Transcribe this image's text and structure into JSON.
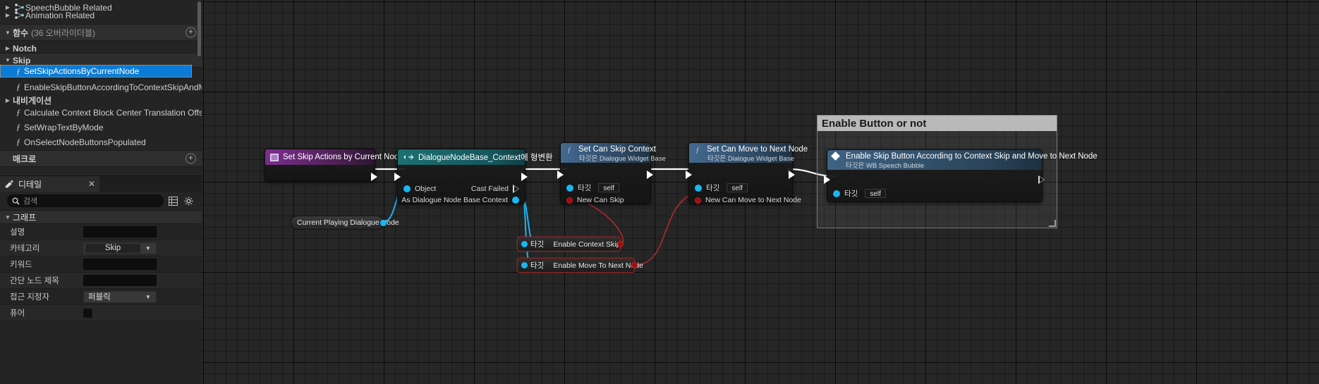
{
  "sidebar": {
    "tree_items": [
      {
        "label": "SpeechBubble Related",
        "type": "category-graph",
        "arrow": "collapsed",
        "indent": 1,
        "selected": false
      },
      {
        "label": "Animation Related",
        "type": "category-graph",
        "arrow": "collapsed",
        "indent": 1,
        "selected": false
      }
    ],
    "functions_header": {
      "label": "함수",
      "count": "(36 오버라이더블)",
      "arrow": "expanded"
    },
    "groups": [
      {
        "label": "Notch",
        "arrow": "collapsed"
      },
      {
        "label": "Skip",
        "arrow": "expanded"
      }
    ],
    "skip_functions": [
      {
        "label": "SetSkipActionsByCurrentNode",
        "selected": true
      },
      {
        "label": "EnableSkipButtonAccordingToContextSkipAndM",
        "selected": false
      }
    ],
    "nav_group": {
      "label": "내비게이션",
      "arrow": "collapsed"
    },
    "nav_functions": [
      {
        "label": "Calculate Context Block Center Translation Offset"
      },
      {
        "label": "SetWrapTextByMode"
      },
      {
        "label": "OnSelectNodeButtonsPopulated"
      }
    ],
    "macro_header": {
      "label": "매크로"
    }
  },
  "details": {
    "tab_title": "디테일",
    "close_icon": "close-icon",
    "search_placeholder": "검색",
    "section_title": "그래프",
    "properties": [
      {
        "name": "설명",
        "control": "text",
        "value": ""
      },
      {
        "name": "카테고리",
        "control": "dropdown",
        "value": "Skip"
      },
      {
        "name": "키워드",
        "control": "text",
        "value": ""
      },
      {
        "name": "간단 노드 제목",
        "control": "text",
        "value": ""
      },
      {
        "name": "접근 지정자",
        "control": "dropdown",
        "value": "퍼블릭"
      },
      {
        "name": "퓨어",
        "control": "checkbox",
        "value": ""
      }
    ]
  },
  "graph": {
    "comment": {
      "title": "Enable Button or not"
    },
    "nodes": [
      {
        "id": "set-skip-actions",
        "title": "Set Skip Actions by Current Node",
        "subtitle": "",
        "icon": "event-node-icon",
        "color": "purple"
      },
      {
        "id": "cast-dialogue-node",
        "title": "DialogueNodeBase_Context에 형변환",
        "subtitle": "",
        "icon": "cast-icon",
        "color": "teal",
        "pins_in": [
          {
            "label": "Object",
            "type": "object"
          }
        ],
        "pins_out": [
          {
            "label": "Cast Failed",
            "type": "exec"
          },
          {
            "label": "As Dialogue Node Base Context",
            "type": "object"
          }
        ]
      },
      {
        "id": "set-can-skip-context",
        "title": "Set Can Skip Context",
        "subtitle": "타깃은 Dialogue Widget Base",
        "icon": "function-icon",
        "color": "blue",
        "pins_in": [
          {
            "label": "타깃",
            "type": "object",
            "value": "self"
          },
          {
            "label": "New Can Skip",
            "type": "bool"
          }
        ]
      },
      {
        "id": "set-can-move-to-next-node",
        "title": "Set Can Move to Next Node",
        "subtitle": "타깃은 Dialogue Widget Base",
        "icon": "function-icon",
        "color": "blue",
        "pins_in": [
          {
            "label": "타깃",
            "type": "object",
            "value": "self"
          },
          {
            "label": "New Can Move to Next Node",
            "type": "bool"
          }
        ]
      },
      {
        "id": "enable-skip-button",
        "title": "Enable Skip Button According to Context Skip and Move to Next Node",
        "subtitle": "타깃은 WB Speech Bubble",
        "icon": "macro-icon",
        "color": "blue2",
        "pins_in": [
          {
            "label": "타깃",
            "type": "object",
            "value": "self"
          }
        ]
      }
    ],
    "variable_nodes": [
      {
        "id": "current-playing-dialogue-node",
        "label": "Current Playing Dialogue Node",
        "type": "object"
      }
    ],
    "bool_nodes": [
      {
        "id": "enable-context-skip",
        "in_label": "타깃",
        "label": "Enable Context Skip"
      },
      {
        "id": "enable-move-to-next-node",
        "in_label": "타깃",
        "label": "Enable Move To Next Node"
      }
    ]
  },
  "colors": {
    "selection_blue": "#0a7bd6",
    "exec_wire": "#ffffff",
    "object_wire": "#18b7f0",
    "bool_wire": "#c02020",
    "node_purple": "#7b2e8e",
    "node_teal": "#1d7070",
    "node_blue": "#44688f",
    "canvas": "#262626"
  }
}
